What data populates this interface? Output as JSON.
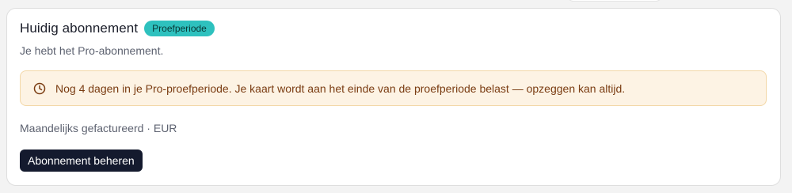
{
  "subscription": {
    "title": "Huidig abonnement",
    "badge": "Proefperiode",
    "subtitle": "Je hebt het Pro-abonnement.",
    "alert": {
      "icon": "clock-icon",
      "text": "Nog 4 dagen in je Pro-proefperiode. Je kaart wordt aan het einde van de proefperiode belast — opzeggen kan altijd."
    },
    "billing_info": "Maandelijks gefactureerd · EUR",
    "manage_button_label": "Abonnement beheren"
  },
  "colors": {
    "badge_bg": "#2ec1be",
    "alert_bg": "#fdf3e4",
    "alert_border": "#f3d8a8",
    "alert_text": "#7a3c12",
    "button_bg": "#141a2e"
  }
}
